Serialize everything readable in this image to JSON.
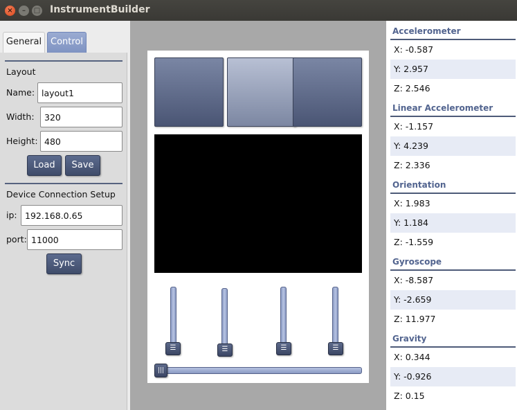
{
  "window": {
    "title": "InstrumentBuilder",
    "close_glyph": "×",
    "min_glyph": "–",
    "max_glyph": "□"
  },
  "tabs": [
    {
      "label": "General",
      "selected": false
    },
    {
      "label": "Control",
      "selected": true
    }
  ],
  "layout": {
    "heading": "Layout",
    "name_label": "Name:",
    "name_value": "layout1",
    "width_label": "Width:",
    "width_value": "320",
    "height_label": "Height:",
    "height_value": "480",
    "load_label": "Load",
    "save_label": "Save"
  },
  "connection": {
    "heading": "Device Connection Setup",
    "ip_label": "ip:",
    "ip_value": "192.168.0.65",
    "port_label": "port:",
    "port_value": "11000",
    "sync_label": "Sync"
  },
  "instrument": {
    "slider_thumb_glyph": "☰",
    "hslider_thumb_glyph": "|||"
  },
  "sensors": [
    {
      "title": "Accelerometer",
      "x": "X: -0.587",
      "y": "Y: 2.957",
      "z": "Z: 2.546"
    },
    {
      "title": "Linear Accelerometer",
      "x": "X: -1.157",
      "y": "Y: 4.239",
      "z": "Z: 2.336"
    },
    {
      "title": "Orientation",
      "x": "X: 1.983",
      "y": "Y: 1.184",
      "z": "Z: -1.559"
    },
    {
      "title": "Gyroscope",
      "x": "X: -8.587",
      "y": "Y: -2.659",
      "z": "Z: 11.977"
    },
    {
      "title": "Gravity",
      "x": "X: 0.344",
      "y": "Y: -0.926",
      "z": "Z: 0.15"
    }
  ]
}
